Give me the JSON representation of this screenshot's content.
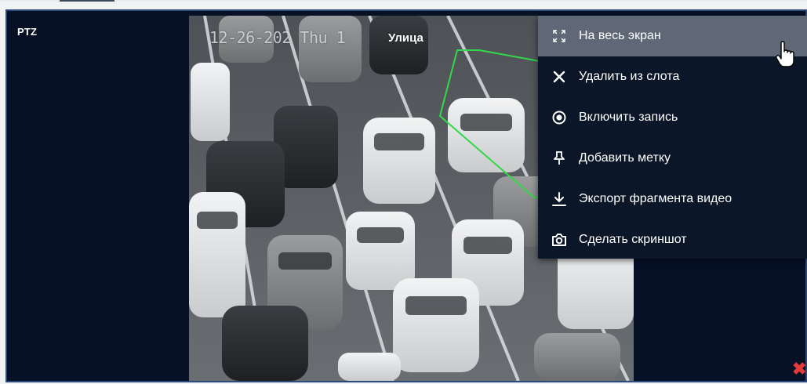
{
  "player": {
    "label": "PTZ",
    "osd_timestamp": "12-26-202  Thu 1",
    "camera_name": "Улица",
    "close_symbol": "✖"
  },
  "context_menu": {
    "items": [
      {
        "label": "На весь экран",
        "icon": "fullscreen-icon"
      },
      {
        "label": "Удалить из слота",
        "icon": "close-icon"
      },
      {
        "label": "Включить запись",
        "icon": "record-icon"
      },
      {
        "label": "Добавить метку",
        "icon": "pin-icon"
      },
      {
        "label": "Экспорт фрагмента видео",
        "icon": "download-icon"
      },
      {
        "label": "Сделать скриншот",
        "icon": "camera-icon"
      }
    ],
    "hovered_index": 0
  },
  "colors": {
    "panel_bg": "#061126",
    "panel_border": "#2c4a7e",
    "menu_bg": "#0b1628",
    "menu_hover": "#5e6876",
    "zone_line": "#33d94a",
    "close_red": "#e53b3b"
  }
}
